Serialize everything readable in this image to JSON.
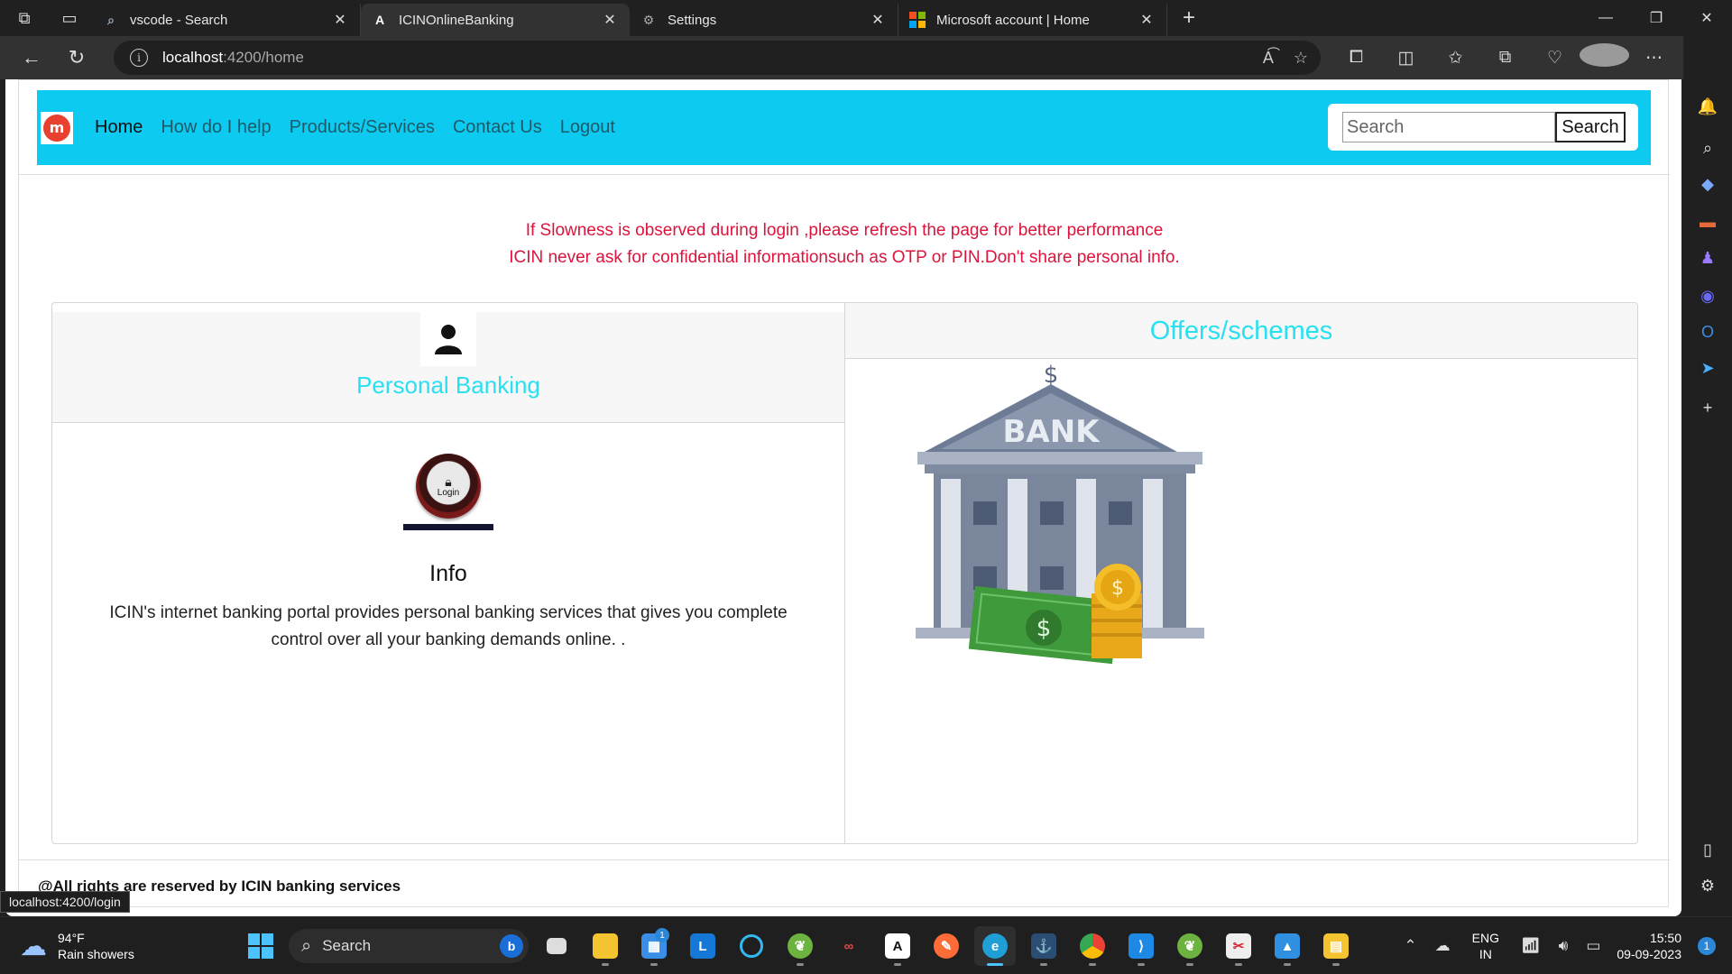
{
  "browser": {
    "tabs": [
      {
        "label": "vscode - Search",
        "icon": "search-icon",
        "active": false
      },
      {
        "label": "ICINOnlineBanking",
        "icon": "angular-icon",
        "active": true
      },
      {
        "label": "Settings",
        "icon": "gear-icon",
        "active": false
      },
      {
        "label": "Microsoft account | Home",
        "icon": "microsoft-icon",
        "active": false
      }
    ],
    "url_host": "localhost",
    "url_path": ":4200/home",
    "status_url": "localhost:4200/login"
  },
  "site": {
    "nav": [
      {
        "label": "Home",
        "active": true
      },
      {
        "label": "How do I help",
        "active": false
      },
      {
        "label": "Products/Services",
        "active": false
      },
      {
        "label": "Contact Us",
        "active": false
      },
      {
        "label": "Logout",
        "active": false
      }
    ],
    "search": {
      "placeholder": "Search",
      "button_label": "Search"
    },
    "notice": {
      "line1": "If Slowness is observed during login ,please refresh the page for better performance",
      "line2": "ICIN never ask for confidential informationsuch as OTP or PIN.Don't share personal info."
    },
    "personal_banking": {
      "title": "Personal Banking",
      "login_badge_label": "Login",
      "info_title": "Info",
      "info_text": "ICIN's internet banking portal provides personal banking services that gives you complete control over all your banking demands online. ."
    },
    "offers": {
      "title": "Offers/schemes",
      "bank_sign": "BANK"
    },
    "footer": "@All rights are reserved by ICIN banking services",
    "accent_color": "#0dcaf0",
    "title_color": "#28e0f0",
    "notice_color": "#dc143c"
  },
  "taskbar": {
    "weather_temp": "94°F",
    "weather_desc": "Rain showers",
    "search_label": "Search",
    "store_badge": "1",
    "language_line1": "ENG",
    "language_line2": "IN",
    "time": "15:50",
    "date": "09-09-2023",
    "notification_count": "1"
  }
}
